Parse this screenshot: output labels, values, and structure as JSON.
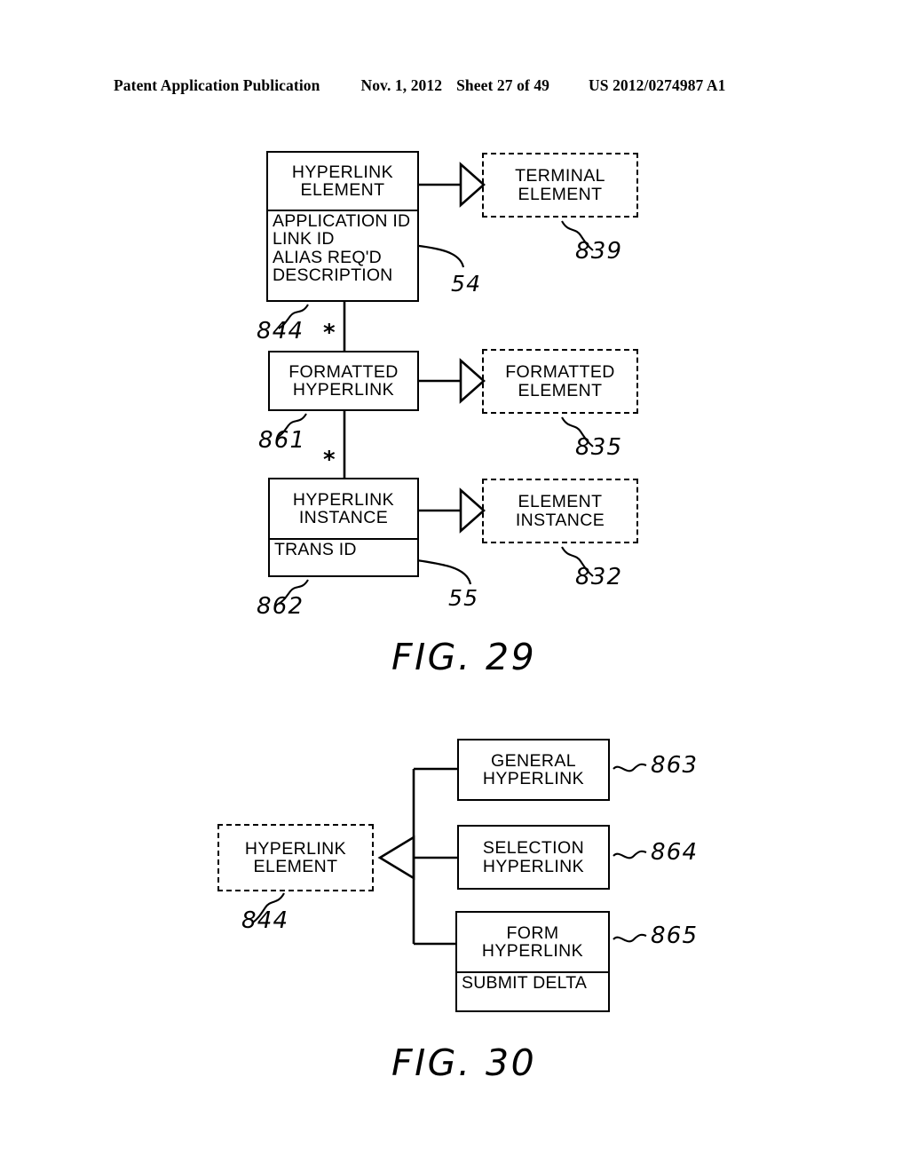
{
  "header": {
    "publication": "Patent Application Publication",
    "date": "Nov. 1, 2012",
    "sheet": "Sheet 27 of 49",
    "number": "US 2012/0274987 A1"
  },
  "figures": [
    {
      "caption": "FIG. 29",
      "nodes": {
        "hyperlink_element": {
          "title": "HYPERLINK\nELEMENT",
          "title_line1": "HYPERLINK",
          "title_line2": "ELEMENT",
          "attributes": [
            "APPLICATION ID",
            "LINK ID",
            "ALIAS REQ'D",
            "DESCRIPTION"
          ],
          "style": "solid",
          "ref": "844"
        },
        "terminal_element": {
          "title_line1": "TERMINAL",
          "title_line2": "ELEMENT",
          "style": "dashed",
          "ref": "839"
        },
        "formatted_hyperlink": {
          "title_line1": "FORMATTED",
          "title_line2": "HYPERLINK",
          "style": "solid",
          "ref": "861"
        },
        "formatted_element": {
          "title_line1": "FORMATTED",
          "title_line2": "ELEMENT",
          "style": "dashed",
          "ref": "835"
        },
        "hyperlink_instance": {
          "title_line1": "HYPERLINK",
          "title_line2": "INSTANCE",
          "attributes": [
            "TRANS ID"
          ],
          "style": "solid",
          "ref": "862"
        },
        "element_instance": {
          "title_line1": "ELEMENT",
          "title_line2": "INSTANCE",
          "style": "dashed",
          "ref": "832"
        }
      },
      "callouts": {
        "link_id_ref": "54",
        "trans_id_ref": "55"
      },
      "multiplicity": [
        "*",
        "*"
      ]
    },
    {
      "caption": "FIG. 30",
      "nodes": {
        "hyperlink_element": {
          "title_line1": "HYPERLINK",
          "title_line2": "ELEMENT",
          "style": "dashed",
          "ref": "844"
        },
        "general_hyperlink": {
          "title_line1": "GENERAL",
          "title_line2": "HYPERLINK",
          "style": "solid",
          "ref": "863"
        },
        "selection_hyperlink": {
          "title_line1": "SELECTION",
          "title_line2": "HYPERLINK",
          "style": "solid",
          "ref": "864"
        },
        "form_hyperlink": {
          "title_line1": "FORM",
          "title_line2": "HYPERLINK",
          "attributes": [
            "SUBMIT DELTA"
          ],
          "style": "solid",
          "ref": "865"
        }
      }
    }
  ]
}
